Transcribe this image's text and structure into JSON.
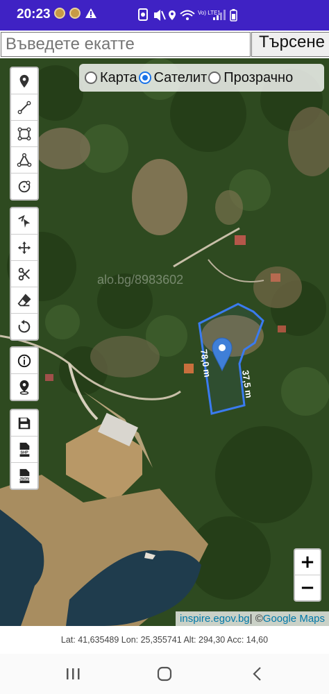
{
  "statusbar": {
    "time": "20:23",
    "network_label": "Vo) LTE1"
  },
  "search": {
    "placeholder": "Въведете екатте",
    "value": "",
    "button_label": "Търсене"
  },
  "layers": [
    {
      "label": "Карта",
      "selected": false
    },
    {
      "label": "Сателит",
      "selected": true
    },
    {
      "label": "Прозрачно",
      "selected": false
    }
  ],
  "tools_draw": [
    "marker-icon",
    "polyline-icon",
    "rectangle-icon",
    "polygon-icon",
    "circle-icon"
  ],
  "tools_edit": [
    "edit-vertices-icon",
    "move-icon",
    "cut-icon",
    "eraser-icon",
    "rotate-icon"
  ],
  "tools_info": [
    "info-icon",
    "locate-icon"
  ],
  "tools_export": {
    "save": "save-icon",
    "shp": "SHP",
    "json": "JSON"
  },
  "map": {
    "watermark": "alo.bg/8983602",
    "measure_left": "78,0 m",
    "measure_right": "37,5 m"
  },
  "zoom": {
    "in": "+",
    "out": "−"
  },
  "attribution": {
    "link": "inspire.egov.bg",
    "separator": " | © ",
    "provider": "Google Maps"
  },
  "gps": {
    "text": "Lat: 41,635489 Lon: 25,355741 Alt: 294,30 Acc: 14,60"
  },
  "colors": {
    "statusbar": "#3f22c4",
    "polygon": "#3a7bf0"
  }
}
